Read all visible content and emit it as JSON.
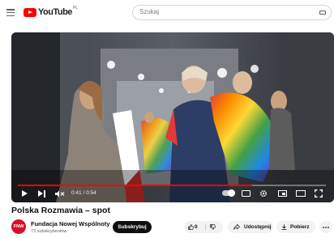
{
  "header": {
    "logo_text": "YouTube",
    "country_code": "PL",
    "search_placeholder": "Szukaj"
  },
  "player": {
    "time_current": "0:41",
    "time_total": "0:54",
    "progress": 0.76,
    "colors": {
      "progress": "#ff0000"
    }
  },
  "video": {
    "title": "Polska Rozmawia – spot"
  },
  "channel": {
    "avatar_text": "FNW",
    "name": "Fundacja Nowej Wspólnoty",
    "subscribers": "73 subskrybentów",
    "subscribe_label": "Subskrybuj"
  },
  "actions": {
    "like_count": "0",
    "share_label": "Udostępnij",
    "download_label": "Pobierz",
    "icons": [
      "thumb-up-icon",
      "thumb-down-icon",
      "share-icon",
      "download-icon",
      "more-icon"
    ]
  }
}
